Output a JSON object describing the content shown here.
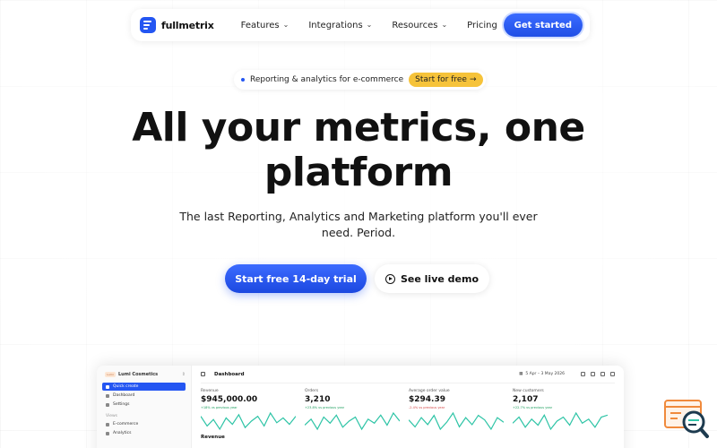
{
  "brand": {
    "name": "fullmetrix"
  },
  "nav": {
    "items": [
      {
        "label": "Features",
        "dropdown": true
      },
      {
        "label": "Integrations",
        "dropdown": true
      },
      {
        "label": "Resources",
        "dropdown": true
      },
      {
        "label": "Pricing",
        "dropdown": false
      }
    ],
    "cta": "Get started"
  },
  "badge": {
    "text": "Reporting & analytics for e-commerce",
    "button": "Start for free",
    "button_icon": "arrow-right-icon"
  },
  "hero": {
    "title_line1": "All your metrics, one",
    "title_line2": "platform",
    "subtitle": "The last Reporting, Analytics and Marketing platform you'll ever need. Period.",
    "primary_button": "Start free 14-day trial",
    "secondary_button": "See live demo",
    "secondary_icon": "play-circle-icon"
  },
  "dashboard": {
    "workspace_logo": "Lumi",
    "workspace": "Lumi Cosmetics",
    "sidebar": [
      {
        "label": "Quick create",
        "active": true
      },
      {
        "label": "Dashboard",
        "active": false
      },
      {
        "label": "Settings",
        "active": false
      }
    ],
    "section_label": "Views",
    "section_items": [
      {
        "label": "E-commerce"
      },
      {
        "label": "Analytics"
      }
    ],
    "title": "Dashboard",
    "date_range": "5 Apr – 3 May 2026",
    "metrics": [
      {
        "label": "Revenue",
        "value": "$945,000.00",
        "delta": "+18% vs previous year",
        "negative": false,
        "points": [
          12,
          6,
          10,
          4,
          11,
          7,
          13,
          5,
          9,
          12,
          6,
          14,
          8,
          11,
          7,
          12
        ]
      },
      {
        "label": "Orders",
        "value": "3,210",
        "delta": "+23.8% vs previous year",
        "negative": false,
        "points": [
          8,
          11,
          6,
          12,
          9,
          13,
          7,
          10,
          12,
          6,
          11,
          9,
          13,
          8,
          14,
          10
        ]
      },
      {
        "label": "Average order value",
        "value": "$294.39",
        "delta": "-2.4% vs previous year",
        "negative": true,
        "points": [
          10,
          7,
          11,
          8,
          12,
          6,
          9,
          13,
          7,
          11,
          8,
          12,
          10,
          6,
          11,
          9
        ]
      },
      {
        "label": "New customers",
        "value": "2,107",
        "delta": "+22.7% vs previous year",
        "negative": false,
        "points": [
          9,
          12,
          7,
          11,
          8,
          13,
          6,
          10,
          12,
          8,
          14,
          9,
          11,
          7,
          12,
          13
        ]
      }
    ],
    "section2": "Revenue"
  },
  "colors": {
    "accent": "#2456f2",
    "badge_button": "#f6c33a",
    "sparkline": "#2ec4a6"
  },
  "widget": {
    "icon": "support-chat-icon"
  }
}
